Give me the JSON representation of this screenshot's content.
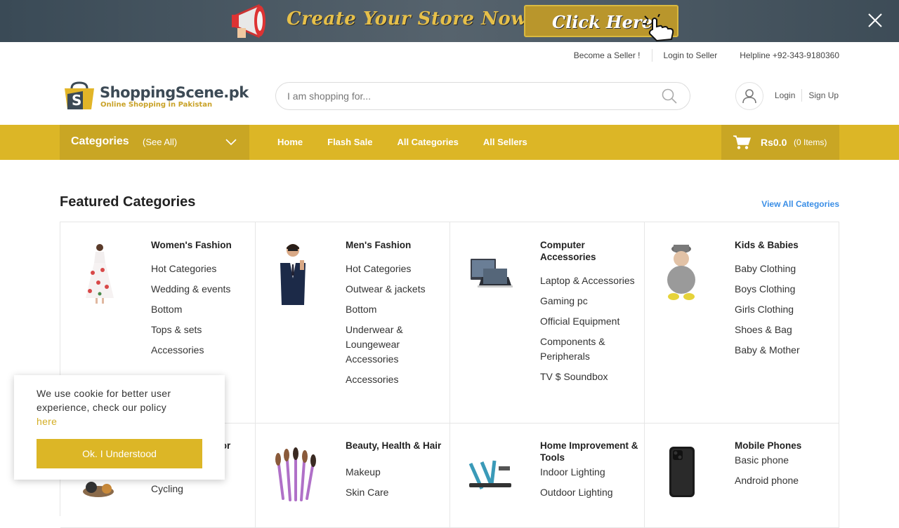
{
  "promo": {
    "headline": "Create Your Store Now Free",
    "cta": "Click Here"
  },
  "top_links": {
    "become_seller": "Become a Seller !",
    "login_seller": "Login to Seller",
    "helpline": "Helpline +92-343-9180360"
  },
  "logo": {
    "name": "ShoppingScene.pk",
    "tagline": "Online Shopping in Pakistan"
  },
  "search": {
    "placeholder": "I am shopping for..."
  },
  "auth": {
    "login": "Login",
    "signup": "Sign Up"
  },
  "nav": {
    "categories": "Categories",
    "see_all": "(See All)",
    "links": [
      "Home",
      "Flash Sale",
      "All Categories",
      "All Sellers"
    ]
  },
  "cart": {
    "amount": "Rs0.0",
    "items": "(0 Items)"
  },
  "featured": {
    "title": "Featured Categories",
    "view_all": "View All Categories",
    "categories": [
      {
        "name": "Women's Fashion",
        "icon": "dress-image",
        "items": [
          "Hot Categories",
          "Wedding & events",
          "Bottom",
          "Tops & sets",
          "Accessories"
        ]
      },
      {
        "name": "Men's Fashion",
        "icon": "suit-man-image",
        "items": [
          "Hot Categories",
          "Outwear & jackets",
          "Bottom",
          "Underwear & Loungewear Accessories",
          "Accessories"
        ]
      },
      {
        "name": "Computer Accessories",
        "icon": "computer-image",
        "items": [
          "Laptop & Accessories",
          "Gaming pc",
          "Official Equipment",
          "Components & Peripherals",
          "TV $ Soundbox"
        ]
      },
      {
        "name": "Kids & Babies",
        "icon": "baby-image",
        "items": [
          "Baby Clothing",
          "Boys Clothing",
          "Girls Clothing",
          "Shoes & Bag",
          "Baby & Mother"
        ]
      },
      {
        "name": "Sports & Outdoor",
        "icon": "sports-image",
        "items": [
          "Cycling"
        ]
      },
      {
        "name": "Beauty, Health & Hair",
        "icon": "makeup-brushes-image",
        "items": [
          "Makeup",
          "Skin Care"
        ]
      },
      {
        "name": "Home Improvement & Tools",
        "icon": "tools-image",
        "items": [
          "Indoor Lighting",
          "Outdoor Lighting"
        ]
      },
      {
        "name": "Mobile Phones",
        "icon": "smartphone-image",
        "items": [
          "Basic phone",
          "Android phone"
        ]
      }
    ]
  },
  "cookie": {
    "text": "We use cookie for better user experience, check our policy",
    "link": "here",
    "button": "Ok. I Understood"
  }
}
